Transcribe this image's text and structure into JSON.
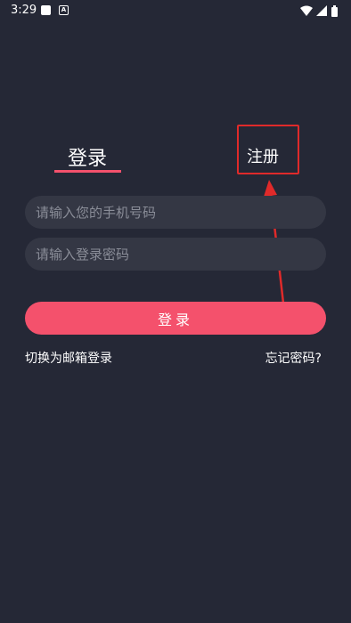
{
  "status_bar": {
    "time": "3:29",
    "notification_icons": [
      "square-notification-icon",
      "a-notification-icon"
    ],
    "notification_letter": "A",
    "right_icons": [
      "wifi-icon",
      "signal-icon",
      "battery-icon"
    ]
  },
  "tabs": {
    "login": "登录",
    "register": "注册"
  },
  "form": {
    "phone_placeholder": "请输入您的手机号码",
    "phone_value": "",
    "password_placeholder": "请输入登录密码",
    "password_value": "",
    "submit_label": "登录"
  },
  "links": {
    "switch_to_email": "切换为邮箱登录",
    "forgot_password": "忘记密码?"
  },
  "colors": {
    "background": "#252836",
    "input_background": "#343744",
    "accent": "#f4516c",
    "annotation": "#e02a2a"
  }
}
